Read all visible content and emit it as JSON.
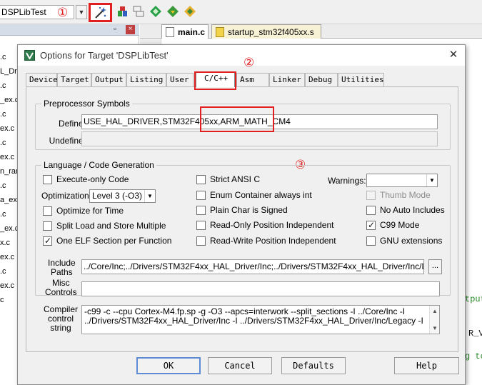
{
  "ide": {
    "target_name": "DSPLibTest",
    "editor_tabs": [
      "main.c",
      "startup_stm32f405xx.s"
    ],
    "file_list": [
      ".c",
      "L_Dri",
      ".c",
      "_ex.c",
      ".c",
      "ex.c",
      ".c",
      "ex.c",
      "n_ran",
      ".c",
      "a_ex.c",
      ".c",
      "_ex.c",
      "x.c",
      "ex.c",
      ".c",
      "ex.c",
      "c"
    ],
    "code_fragments": [
      "tput",
      "R_VC",
      "g to"
    ]
  },
  "markers": {
    "one": "①",
    "two": "②",
    "three": "③"
  },
  "dialog": {
    "title": "Options for Target 'DSPLibTest'",
    "close_glyph": "✕",
    "tabs": [
      "Device",
      "Target",
      "Output",
      "Listing",
      "User",
      "C/C++",
      "Asm",
      "Linker",
      "Debug",
      "Utilities"
    ],
    "active_tab": "C/C++",
    "preprocessor": {
      "group_label": "Preprocessor Symbols",
      "define_label": "Define:",
      "define_value": "USE_HAL_DRIVER,STM32F405xx,ARM_MATH_CM4",
      "undefine_label": "Undefine:",
      "undefine_value": ""
    },
    "language": {
      "group_label": "Language / Code Generation",
      "execute_only": {
        "label": "Execute-only Code",
        "checked": false
      },
      "optimization_label": "Optimization:",
      "optimization_value": "Level 3 (-O3)",
      "optimize_for_time": {
        "label": "Optimize for Time",
        "checked": false
      },
      "split_load_store": {
        "label": "Split Load and Store Multiple",
        "checked": false
      },
      "one_elf_section": {
        "label": "One ELF Section per Function",
        "checked": true
      },
      "strict_ansi": {
        "label": "Strict ANSI C",
        "checked": false
      },
      "enum_container": {
        "label": "Enum Container always int",
        "checked": false
      },
      "plain_char_signed": {
        "label": "Plain Char is Signed",
        "checked": false
      },
      "ro_position_independent": {
        "label": "Read-Only Position Independent",
        "checked": false
      },
      "rw_position_independent": {
        "label": "Read-Write Position Independent",
        "checked": false
      },
      "warnings_label": "Warnings:",
      "warnings_value": "",
      "thumb_mode": {
        "label": "Thumb Mode",
        "checked": false,
        "disabled": true
      },
      "no_auto_includes": {
        "label": "No Auto Includes",
        "checked": false
      },
      "c99_mode": {
        "label": "C99 Mode",
        "checked": true
      },
      "gnu_extensions": {
        "label": "GNU extensions",
        "checked": false
      }
    },
    "include_paths": {
      "label_line1": "Include",
      "label_line2": "Paths",
      "value": "../Core/Inc;../Drivers/STM32F4xx_HAL_Driver/Inc;../Drivers/STM32F4xx_HAL_Driver/Inc/Legacy;",
      "browse_label": "..."
    },
    "misc_controls": {
      "label_line1": "Misc",
      "label_line2": "Controls",
      "value": ""
    },
    "compiler_control": {
      "label_line1": "Compiler",
      "label_line2": "control",
      "label_line3": "string",
      "line1": "-c99 -c --cpu Cortex-M4.fp.sp -g -O3 --apcs=interwork --split_sections -I ../Core/Inc -I",
      "line2": "../Drivers/STM32F4xx_HAL_Driver/Inc -I ../Drivers/STM32F4xx_HAL_Driver/Inc/Legacy -I"
    },
    "buttons": {
      "ok": "OK",
      "cancel": "Cancel",
      "defaults": "Defaults",
      "help": "Help"
    }
  }
}
